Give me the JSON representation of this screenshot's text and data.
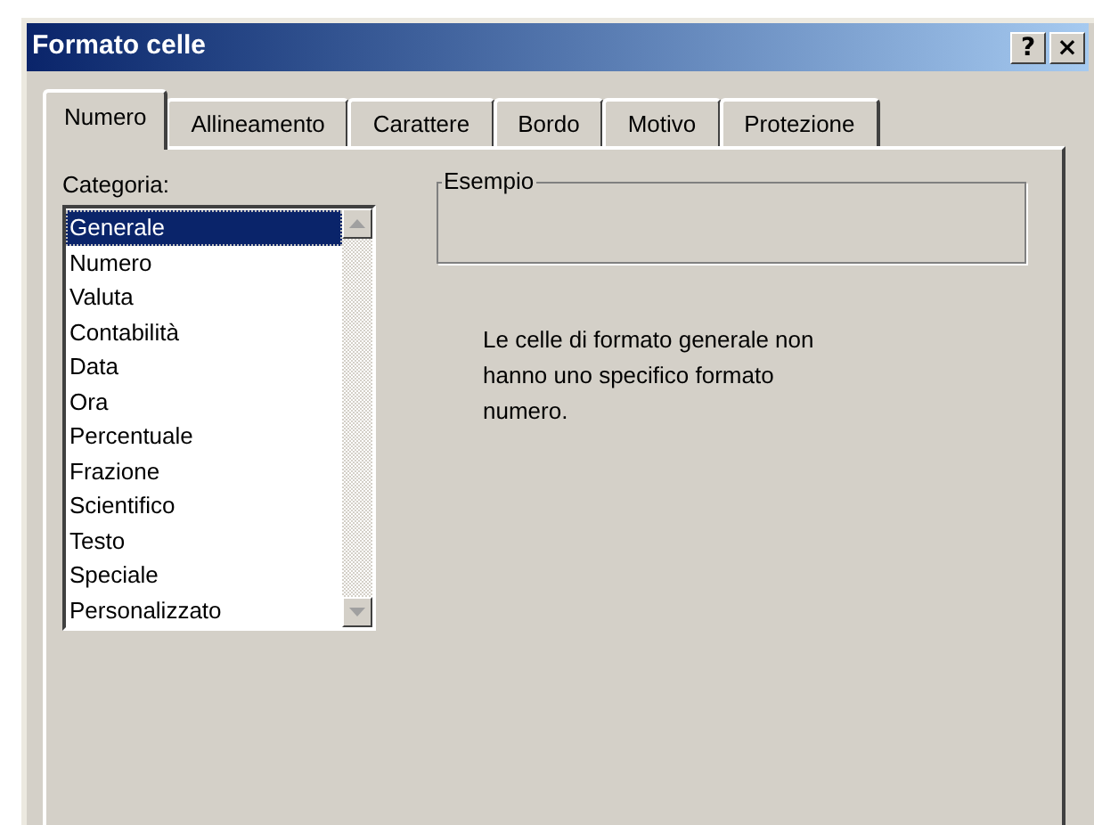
{
  "window": {
    "title": "Formato celle",
    "buttons": [
      {
        "kind": "help",
        "label": "?"
      },
      {
        "kind": "close",
        "label": "×"
      }
    ]
  },
  "tabs": [
    {
      "label": "Numero",
      "selected": true
    },
    {
      "label": "Allineamento",
      "selected": false
    },
    {
      "label": "Carattere",
      "selected": false
    },
    {
      "label": "Bordo",
      "selected": false
    },
    {
      "label": "Motivo",
      "selected": false
    },
    {
      "label": "Protezione",
      "selected": false
    }
  ],
  "category": {
    "label": "Categoria:",
    "items": [
      {
        "label": "Generale",
        "selected": true
      },
      {
        "label": "Numero",
        "selected": false
      },
      {
        "label": "Valuta",
        "selected": false
      },
      {
        "label": "Contabilità",
        "selected": false
      },
      {
        "label": "Data",
        "selected": false
      },
      {
        "label": "Ora",
        "selected": false
      },
      {
        "label": "Percentuale",
        "selected": false
      },
      {
        "label": "Frazione",
        "selected": false
      },
      {
        "label": "Scientifico",
        "selected": false
      },
      {
        "label": "Testo",
        "selected": false
      },
      {
        "label": "Speciale",
        "selected": false
      },
      {
        "label": "Personalizzato",
        "selected": false
      }
    ]
  },
  "sample": {
    "label": "Esempio"
  },
  "description": "Le celle di formato generale non hanno uno specifico formato numero."
}
